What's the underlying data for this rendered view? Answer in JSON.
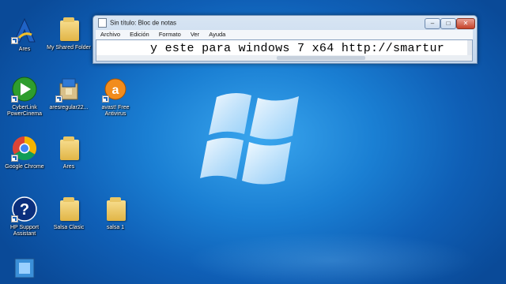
{
  "desktop": {
    "icons": [
      {
        "label": "Ares",
        "icon": "ares-icon"
      },
      {
        "label": "My Shared Folder",
        "icon": "folder-icon"
      },
      {
        "label": "CyberLink PowerCinema",
        "icon": "powercinema-icon"
      },
      {
        "label": "aresregular22...",
        "icon": "installer-icon"
      },
      {
        "label": "avast! Free Antivirus",
        "icon": "avast-icon"
      },
      {
        "label": "Google Chrome",
        "icon": "chrome-icon"
      },
      {
        "label": "Ares",
        "icon": "folder-icon"
      },
      {
        "label": "HP Support Assistant",
        "icon": "hp-support-icon"
      },
      {
        "label": "Salsa Clasic",
        "icon": "folder-icon"
      },
      {
        "label": "salsa 1",
        "icon": "folder-icon"
      }
    ]
  },
  "notepad": {
    "title": "Sin título: Bloc de notas",
    "menu": [
      "Archivo",
      "Edición",
      "Formato",
      "Ver",
      "Ayuda"
    ],
    "text": "y este para windows 7 x64 http://smartur",
    "buttons": {
      "minimize": "–",
      "maximize": "□",
      "close": "✕"
    }
  },
  "colors": {
    "wallpaper": "#1a7fd3",
    "window_frame": "#c3d6ec",
    "close_button": "#c6432a"
  }
}
